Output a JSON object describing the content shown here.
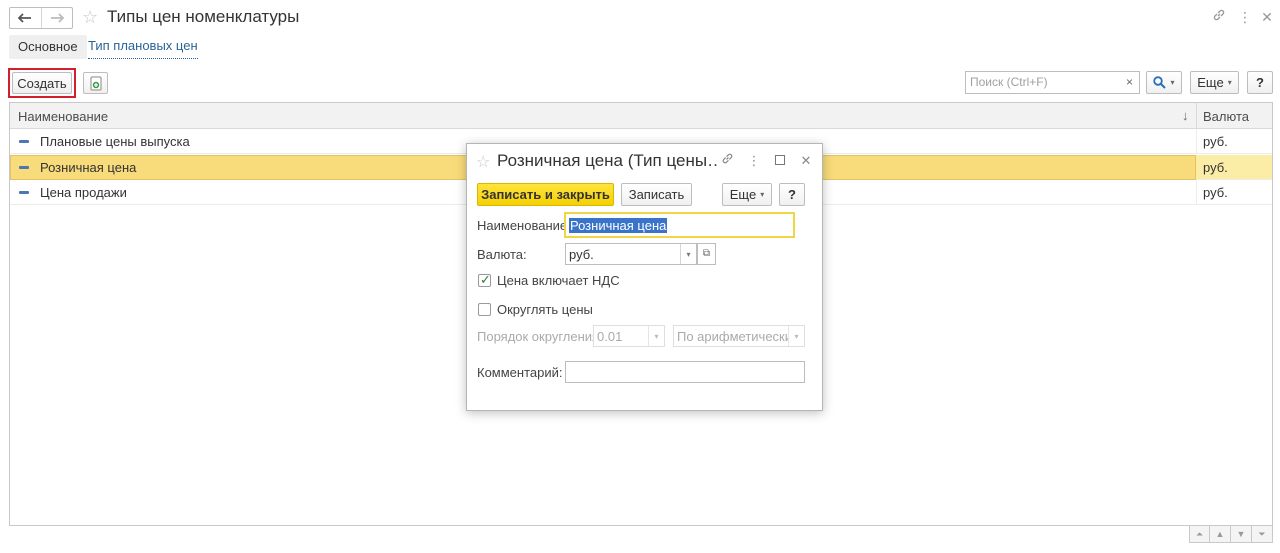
{
  "header": {
    "title": "Типы цен номенклатуры",
    "back_icon": "arrow-left-icon",
    "forward_icon": "arrow-right-icon"
  },
  "tabs": [
    {
      "label": "Основное"
    },
    {
      "label": "Тип плановых цен"
    }
  ],
  "toolbar": {
    "create_label": "Создать",
    "search_placeholder": "Поиск (Ctrl+F)",
    "clear_label": "×",
    "more_label": "Еще",
    "help_label": "?"
  },
  "table": {
    "columns": [
      "Наименование",
      "Валюта"
    ],
    "sort_indicator": "↓",
    "rows": [
      {
        "name": "Плановые цены выпуска",
        "currency": "руб."
      },
      {
        "name": "Розничная цена",
        "currency": "руб."
      },
      {
        "name": "Цена продажи",
        "currency": "руб."
      }
    ]
  },
  "dialog": {
    "title": "Розничная цена (Тип цены…",
    "save_close_label": "Записать и закрыть",
    "save_label": "Записать",
    "more_label": "Еще",
    "help_label": "?",
    "name_label": "Наименование:",
    "name_value": "Розничная цена",
    "currency_label": "Валюта:",
    "currency_value": "руб.",
    "vat_label": "Цена включает НДС",
    "vat_checked": true,
    "round_label": "Округлять цены",
    "round_checked": false,
    "rounding_order_label": "Порядок округления:",
    "rounding_order_value": "0.01",
    "rounding_method_value": "По арифметическим",
    "comment_label": "Комментарий:",
    "comment_value": ""
  },
  "colors": {
    "accent_yellow": "#f5d000",
    "selected_row": "#f8db7a",
    "highlight_red": "#d0202d",
    "link_blue": "#2a6496"
  }
}
